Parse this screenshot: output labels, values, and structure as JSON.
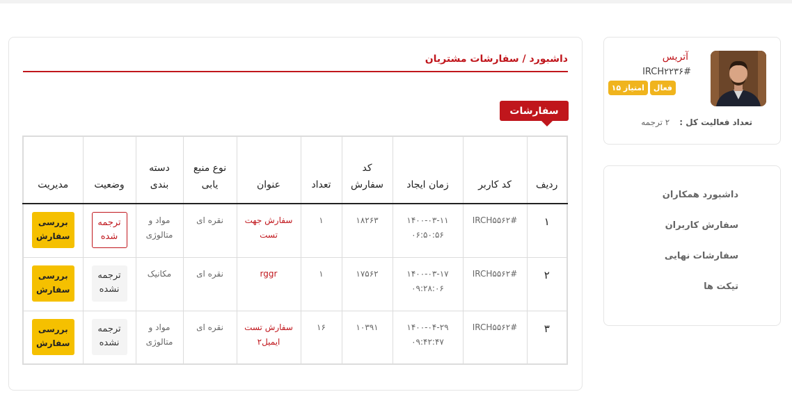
{
  "profile": {
    "name": "آتریس",
    "code": "#IRCH۲۲۳۶",
    "badges": [
      "فعال",
      "۱۵ امتیاز"
    ],
    "activity_label": "تعداد فعالیت کل :",
    "activity_value": "۲ ترجمه"
  },
  "nav": {
    "items": [
      "داشبورد همکاران",
      "سفارش کاربران",
      "سفارشات نهایی",
      "تیکت ها"
    ]
  },
  "breadcrumb": "داشبورد / سفارشات مشتریان",
  "section_tab": "سفارشات",
  "table": {
    "headers": [
      "ردیف",
      "کد کاربر",
      "زمان ایجاد",
      "کد سفارش",
      "تعداد",
      "عنوان",
      "نوع منبع یابی",
      "دسته بندی",
      "وضعیت",
      "مدیریت"
    ],
    "rows": [
      {
        "row": "۱",
        "user_code": "#IRCH۵۵۶۲",
        "created_date": "۱۴۰۰-۰۳-۱۱",
        "created_time": "۰۶:۵۰:۵۶",
        "order_code": "۱۸۲۶۳",
        "qty": "۱",
        "title": "سفارش جهت تست",
        "source": "نقره ای",
        "category": "مواد و متالوژی",
        "status": "ترجمه شده",
        "status_type": "translated",
        "action": "بررسی سفارش"
      },
      {
        "row": "۲",
        "user_code": "#IRCH۵۵۶۲",
        "created_date": "۱۴۰۰-۰۳-۱۷",
        "created_time": "۰۹:۲۸:۰۶",
        "order_code": "۱۷۵۶۲",
        "qty": "۱",
        "title": "rggr",
        "source": "نقره ای",
        "category": "مکانیک",
        "status": "ترجمه نشده",
        "status_type": "untranslated",
        "action": "بررسی سفارش"
      },
      {
        "row": "۳",
        "user_code": "#IRCH۵۵۶۲",
        "created_date": "۱۴۰۰-۰۴-۲۹",
        "created_time": "۰۹:۴۲:۴۷",
        "order_code": "۱۰۳۹۱",
        "qty": "۱۶",
        "title": "سفارش تست ایمیل۲",
        "source": "نقره ای",
        "category": "مواد و متالوژی",
        "status": "ترجمه نشده",
        "status_type": "untranslated",
        "action": "بررسی سفارش"
      }
    ]
  },
  "colors": {
    "accent": "#c0161c",
    "badge": "#f0b41d",
    "action": "#f5c000"
  }
}
